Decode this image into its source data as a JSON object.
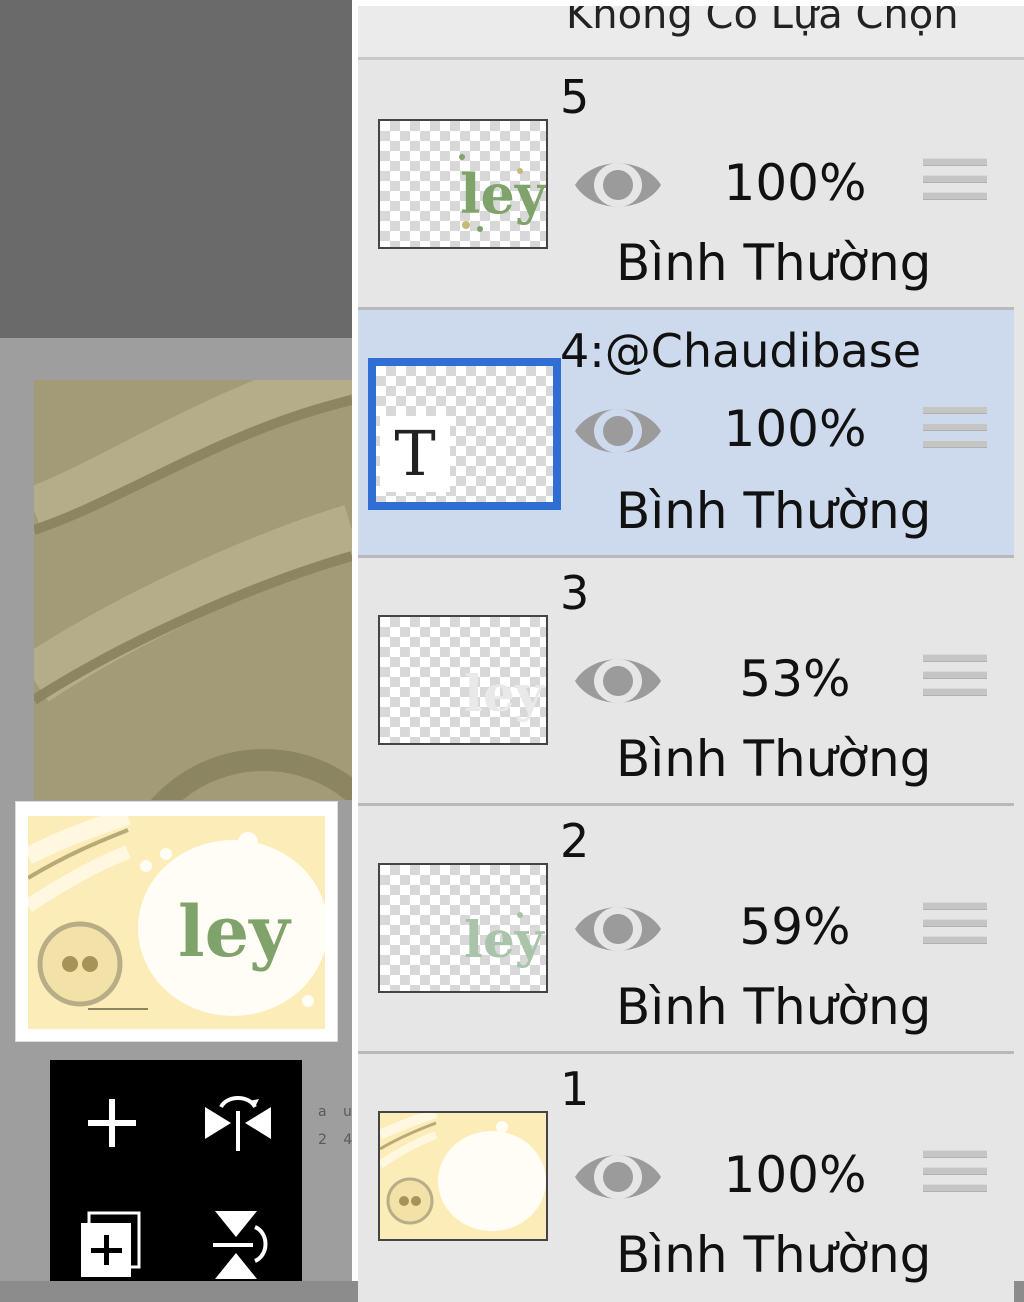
{
  "panel": {
    "header_label": "Không Có Lựa Chọn"
  },
  "layers": [
    {
      "name": "5",
      "opacity": "100%",
      "blend": "Bình Thường",
      "visible": true,
      "selected": false,
      "thumb": "ley-text"
    },
    {
      "name": "4:@Chaudibase",
      "opacity": "100%",
      "blend": "Bình Thường",
      "visible": true,
      "selected": true,
      "thumb": "text-T",
      "thumb_glyph": "T"
    },
    {
      "name": "3",
      "opacity": "53%",
      "blend": "Bình Thường",
      "visible": true,
      "selected": false,
      "thumb": "ley-faint"
    },
    {
      "name": "2",
      "opacity": "59%",
      "blend": "Bình Thường",
      "visible": true,
      "selected": false,
      "thumb": "ley-light"
    },
    {
      "name": "1",
      "opacity": "100%",
      "blend": "Bình Thường",
      "visible": true,
      "selected": false,
      "thumb": "background-art"
    }
  ],
  "toolbar": {
    "icons": [
      "plus-icon",
      "flip-horizontal-icon",
      "add-layer-icon",
      "flip-vertical-icon"
    ]
  },
  "canvas": {
    "tiny_text": "a u\n2 4"
  },
  "colors": {
    "selected_row": "#cdd9ec",
    "selection_border": "#2f6fd4",
    "art_cream": "#fbecb8",
    "art_green": "#7fa36a"
  }
}
